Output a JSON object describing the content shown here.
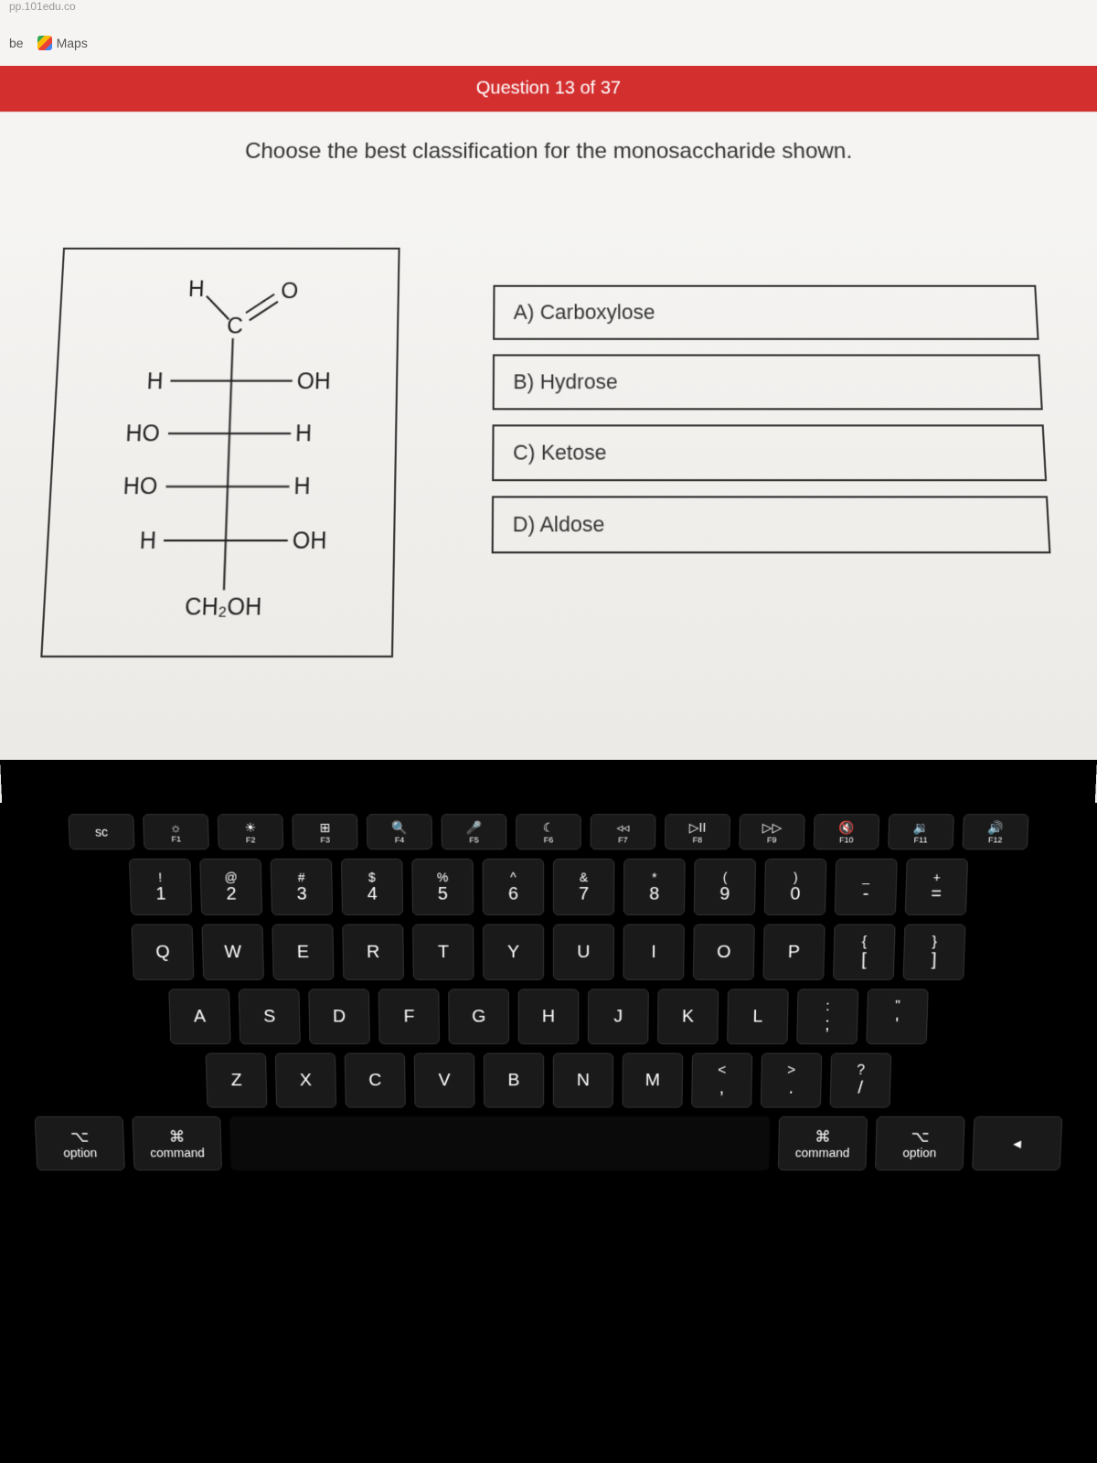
{
  "browser": {
    "url_fragment": "pp.101edu.co",
    "tube_label": "be",
    "maps_label": "Maps"
  },
  "quiz": {
    "header": "Question 13 of 37",
    "prompt": "Choose the best classification for the monosaccharide shown.",
    "options": [
      "A) Carboxylose",
      "B) Hydrose",
      "C) Ketose",
      "D) Aldose"
    ],
    "fab": "+"
  },
  "molecule": {
    "top_h": "H",
    "aldehyde_c": "C",
    "aldehyde_o": "O",
    "row2_left": "H",
    "row2_right": "OH",
    "row3_left": "HO",
    "row3_right": "H",
    "row4_left": "HO",
    "row4_right": "H",
    "row5_left": "H",
    "row5_right": "OH",
    "bottom": "CH₂OH"
  },
  "keyboard": {
    "fn_row": [
      {
        "icon": "sc",
        "sub": ""
      },
      {
        "icon": "☼",
        "sub": "F1"
      },
      {
        "icon": "☀",
        "sub": "F2"
      },
      {
        "icon": "⊞",
        "sub": "F3"
      },
      {
        "icon": "🔍",
        "sub": "F4"
      },
      {
        "icon": "🎤",
        "sub": "F5"
      },
      {
        "icon": "☾",
        "sub": "F6"
      },
      {
        "icon": "◃◃",
        "sub": "F7"
      },
      {
        "icon": "▷II",
        "sub": "F8"
      },
      {
        "icon": "▷▷",
        "sub": "F9"
      },
      {
        "icon": "🔇",
        "sub": "F10"
      },
      {
        "icon": "🔉",
        "sub": "F11"
      },
      {
        "icon": "🔊",
        "sub": "F12"
      }
    ],
    "num_row": [
      {
        "top": "!",
        "bot": "1"
      },
      {
        "top": "@",
        "bot": "2"
      },
      {
        "top": "#",
        "bot": "3"
      },
      {
        "top": "$",
        "bot": "4"
      },
      {
        "top": "%",
        "bot": "5"
      },
      {
        "top": "^",
        "bot": "6"
      },
      {
        "top": "&",
        "bot": "7"
      },
      {
        "top": "*",
        "bot": "8"
      },
      {
        "top": "(",
        "bot": "9"
      },
      {
        "top": ")",
        "bot": "0"
      },
      {
        "top": "_",
        "bot": "-"
      },
      {
        "top": "+",
        "bot": "="
      }
    ],
    "row_q": [
      "Q",
      "W",
      "E",
      "R",
      "T",
      "Y",
      "U",
      "I",
      "O",
      "P"
    ],
    "row_q_extra": [
      {
        "top": "{",
        "bot": "["
      },
      {
        "top": "}",
        "bot": "]"
      }
    ],
    "row_a": [
      "A",
      "S",
      "D",
      "F",
      "G",
      "H",
      "J",
      "K",
      "L"
    ],
    "row_a_extra": [
      {
        "top": ":",
        "bot": ";"
      },
      {
        "top": "\"",
        "bot": "'"
      }
    ],
    "row_z": [
      "Z",
      "X",
      "C",
      "V",
      "B",
      "N",
      "M"
    ],
    "row_z_extra": [
      {
        "top": "<",
        "bot": ","
      },
      {
        "top": ">",
        "bot": "."
      },
      {
        "top": "?",
        "bot": "/"
      }
    ],
    "bottom_left": [
      {
        "icon": "⌥",
        "label": "option"
      },
      {
        "icon": "⌘",
        "label": "command"
      }
    ],
    "bottom_right": [
      {
        "icon": "⌘",
        "label": "command"
      },
      {
        "icon": "⌥",
        "label": "option"
      },
      {
        "icon": "◂",
        "label": ""
      }
    ]
  }
}
